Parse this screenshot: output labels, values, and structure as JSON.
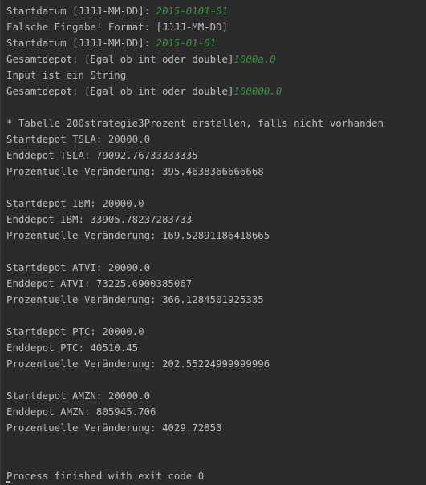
{
  "console": {
    "lines": [
      {
        "prompt": "Startdatum [JJJJ-MM-DD]: ",
        "input": "2015-0101-01"
      },
      {
        "text": "Falsche Eingabe! Format: [JJJJ-MM-DD]"
      },
      {
        "prompt": "Startdatum [JJJJ-MM-DD]: ",
        "input": "2015-01-01"
      },
      {
        "prompt": "Gesamtdepot: [Egal ob int oder double]",
        "input": "1000a.0"
      },
      {
        "text": "Input ist ein String"
      },
      {
        "prompt": "Gesamtdepot: [Egal ob int oder double]",
        "input": "100000.0"
      },
      {
        "text": ""
      },
      {
        "text": "* Tabelle 200strategie3Prozent erstellen, falls nicht vorhanden"
      },
      {
        "text": "Startdepot TSLA: 20000.0"
      },
      {
        "text": "Enddepot TSLA: 79092.76733333335"
      },
      {
        "text": "Prozentuelle Veränderung: 395.4638366666668"
      },
      {
        "text": ""
      },
      {
        "text": "Startdepot IBM: 20000.0"
      },
      {
        "text": "Enddepot IBM: 33905.78237283733"
      },
      {
        "text": "Prozentuelle Veränderung: 169.52891186418665"
      },
      {
        "text": ""
      },
      {
        "text": "Startdepot ATVI: 20000.0"
      },
      {
        "text": "Enddepot ATVI: 73225.6900385067"
      },
      {
        "text": "Prozentuelle Veränderung: 366.1284501925335"
      },
      {
        "text": ""
      },
      {
        "text": "Startdepot PTC: 20000.0"
      },
      {
        "text": "Enddepot PTC: 40510.45"
      },
      {
        "text": "Prozentuelle Veränderung: 202.55224999999996"
      },
      {
        "text": ""
      },
      {
        "text": "Startdepot AMZN: 20000.0"
      },
      {
        "text": "Enddepot AMZN: 805945.706"
      },
      {
        "text": "Prozentuelle Veränderung: 4029.72853"
      },
      {
        "text": ""
      },
      {
        "text": ""
      },
      {
        "text": "Process finished with exit code 0"
      }
    ]
  },
  "colors": {
    "background": "#2b2b2b",
    "text": "#bbbbbb",
    "user_input": "#2f9a3a"
  }
}
